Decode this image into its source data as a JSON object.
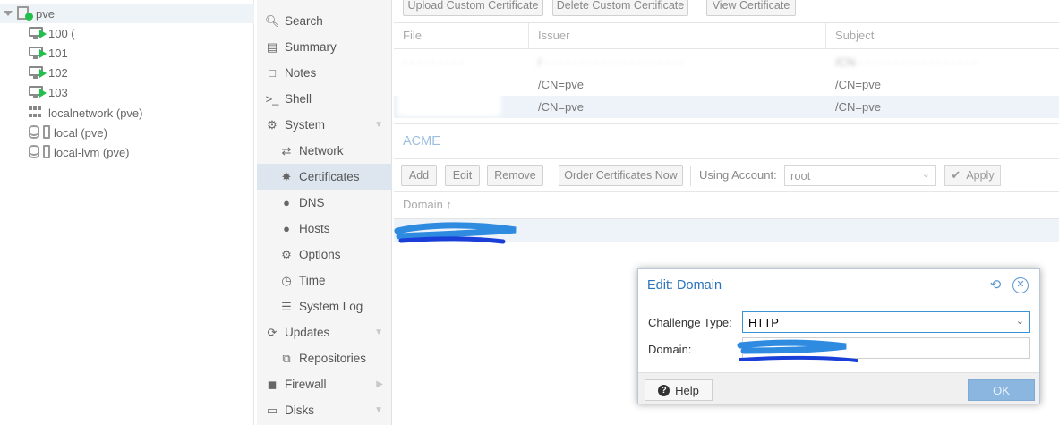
{
  "tree": {
    "root": {
      "label": "pve",
      "icon": "node-online-icon"
    },
    "vms": [
      {
        "label": "100 (",
        "icon": "vm-running-icon"
      },
      {
        "label": "101",
        "icon": "vm-running-icon"
      },
      {
        "label": "102",
        "icon": "vm-running-icon"
      },
      {
        "label": "103",
        "icon": "vm-running-icon"
      }
    ],
    "network": {
      "label": "localnetwork (pve)",
      "icon": "sdn-grid-icon"
    },
    "storages": [
      {
        "label": "local (pve)",
        "icon": "storage-icon"
      },
      {
        "label": "local-lvm (pve)",
        "icon": "storage-icon"
      }
    ]
  },
  "nav": {
    "items": [
      {
        "label": "Search",
        "icon": "search-icon"
      },
      {
        "label": "Summary",
        "icon": "book-icon"
      },
      {
        "label": "Notes",
        "icon": "notes-icon"
      },
      {
        "label": "Shell",
        "icon": "terminal-icon"
      },
      {
        "label": "System",
        "icon": "cogs-icon"
      },
      {
        "label": "Network",
        "icon": "exchange-icon"
      },
      {
        "label": "Certificates",
        "icon": "certificate-icon"
      },
      {
        "label": "DNS",
        "icon": "globe-icon"
      },
      {
        "label": "Hosts",
        "icon": "globe-icon"
      },
      {
        "label": "Options",
        "icon": "gear-icon"
      },
      {
        "label": "Time",
        "icon": "clock-icon"
      },
      {
        "label": "System Log",
        "icon": "list-icon"
      },
      {
        "label": "Updates",
        "icon": "refresh-icon"
      },
      {
        "label": "Repositories",
        "icon": "files-icon"
      },
      {
        "label": "Firewall",
        "icon": "shield-icon"
      },
      {
        "label": "Disks",
        "icon": "drive-icon"
      }
    ]
  },
  "certs": {
    "toolbar": {
      "upload": "Upload Custom Certificate",
      "delete": "Delete Custom Certificate",
      "view": "View Certificate"
    },
    "columns": {
      "file": "File",
      "issuer": "Issuer",
      "subject": "Subject"
    },
    "rows": [
      {
        "issuer": "/CN=pve",
        "subject": "/CN=pve"
      },
      {
        "issuer": "/CN=pve",
        "subject": "/CN=pve"
      }
    ]
  },
  "acme": {
    "title": "ACME",
    "toolbar": {
      "add": "Add",
      "edit": "Edit",
      "remove": "Remove",
      "order": "Order Certificates Now",
      "account_label": "Using Account:",
      "account_value": "root",
      "apply": "Apply"
    },
    "columns": {
      "domain": "Domain ↑"
    }
  },
  "dialog": {
    "title": "Edit: Domain",
    "challenge_label": "Challenge Type:",
    "challenge_value": "HTTP",
    "domain_label": "Domain:",
    "help": "Help",
    "ok": "OK"
  },
  "colors": {
    "accent": "#2b73bd",
    "selection": "#dde6ef",
    "scribble": "#1a3fd8",
    "scribble_light": "#2e8be0"
  }
}
